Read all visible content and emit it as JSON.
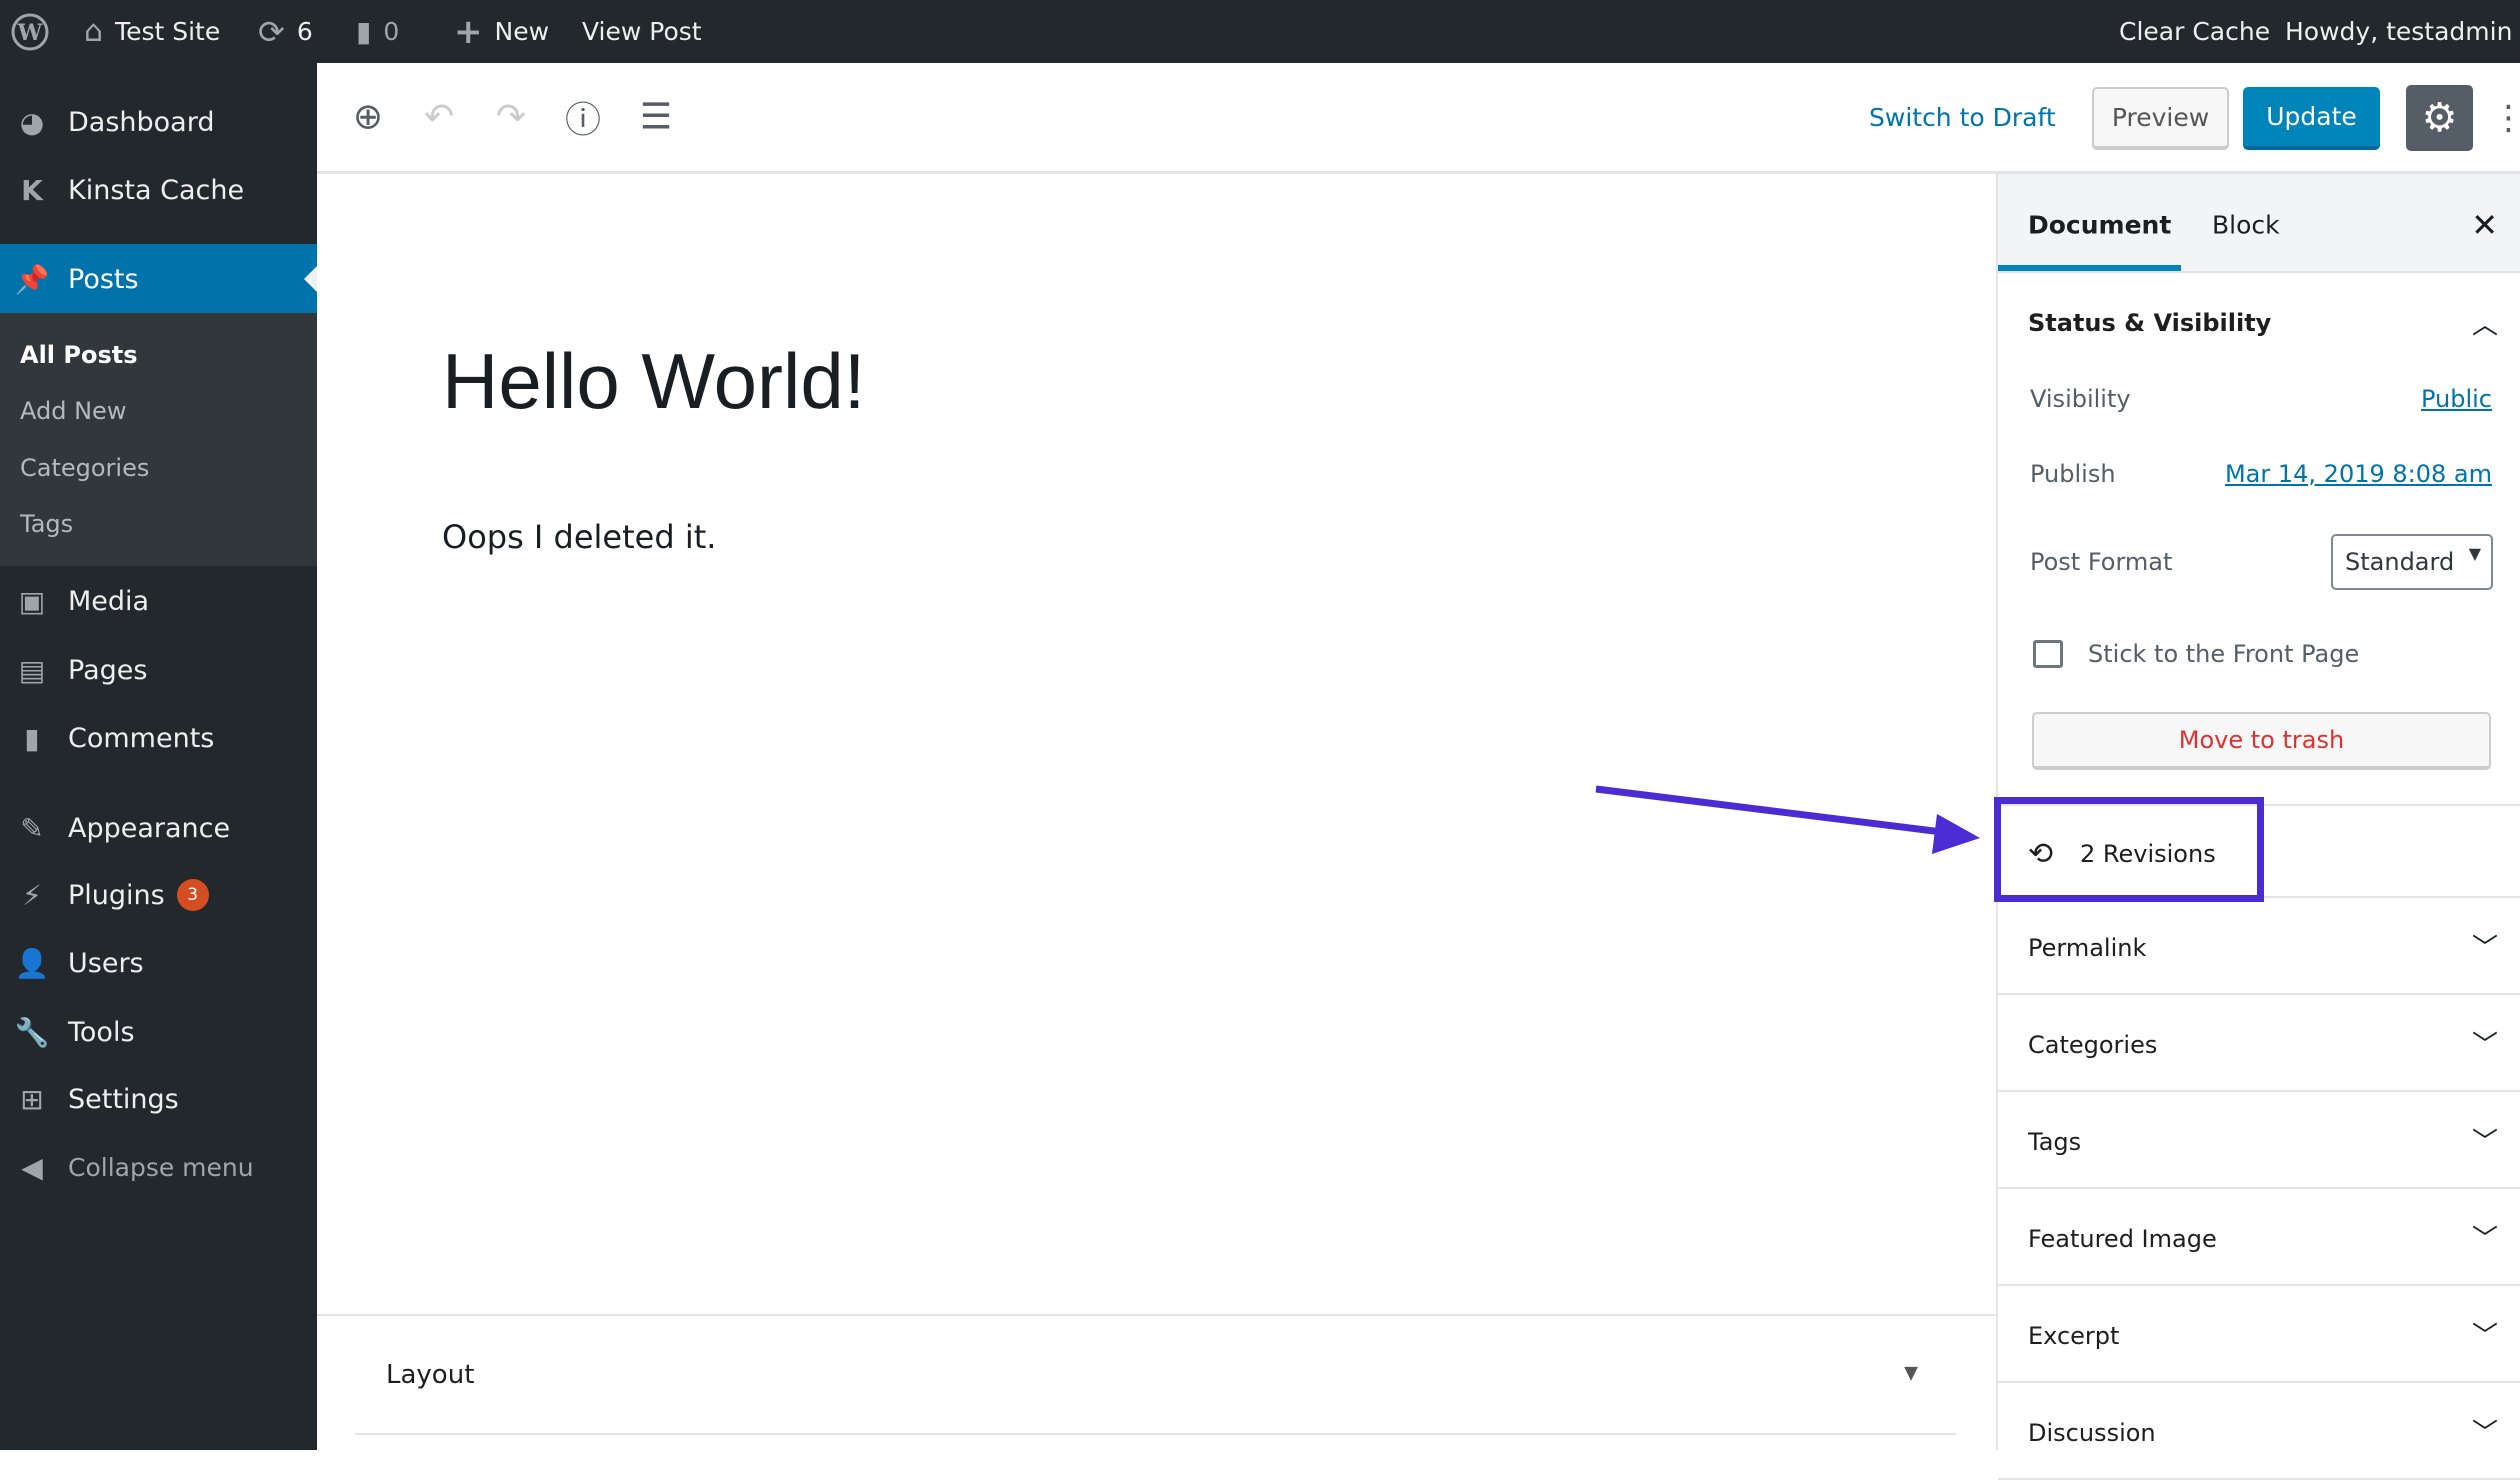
{
  "adminbar": {
    "site": "Test Site",
    "updates": "6",
    "comments": "0",
    "new": "New",
    "view_post": "View Post",
    "clear_cache": "Clear Cache",
    "howdy": "Howdy, testadmin"
  },
  "sidebar": {
    "items": [
      {
        "label": "Dashboard",
        "icon": "dashboard-icon"
      },
      {
        "label": "Kinsta Cache",
        "icon": "kinsta-icon"
      },
      {
        "label": "Posts",
        "icon": "pin-icon"
      },
      {
        "label": "Media",
        "icon": "media-icon"
      },
      {
        "label": "Pages",
        "icon": "pages-icon"
      },
      {
        "label": "Comments",
        "icon": "comments-icon"
      },
      {
        "label": "Appearance",
        "icon": "brush-icon"
      },
      {
        "label": "Plugins",
        "icon": "plugin-icon",
        "badge": "3"
      },
      {
        "label": "Users",
        "icon": "users-icon"
      },
      {
        "label": "Tools",
        "icon": "wrench-icon"
      },
      {
        "label": "Settings",
        "icon": "settings-icon"
      },
      {
        "label": "Collapse menu",
        "icon": "collapse-icon"
      }
    ],
    "submenu": [
      "All Posts",
      "Add New",
      "Categories",
      "Tags"
    ]
  },
  "toolbar": {
    "switch_draft": "Switch to Draft",
    "preview": "Preview",
    "update": "Update"
  },
  "editor": {
    "title": "Hello World!",
    "paragraph": "Oops I deleted it.",
    "layout": "Layout"
  },
  "panel": {
    "tabs": [
      "Document",
      "Block"
    ],
    "status_title": "Status & Visibility",
    "visibility_label": "Visibility",
    "visibility_value": "Public",
    "publish_label": "Publish",
    "publish_value": "Mar 14, 2019 8:08 am",
    "format_label": "Post Format",
    "format_value": "Standard",
    "sticky": "Stick to the Front Page",
    "trash": "Move to trash",
    "revisions": "2 Revisions",
    "sections": [
      "Permalink",
      "Categories",
      "Tags",
      "Featured Image",
      "Excerpt",
      "Discussion"
    ]
  },
  "colors": {
    "accent": "#0073aa",
    "highlight": "#4a2bd4",
    "danger": "#dc3232"
  }
}
